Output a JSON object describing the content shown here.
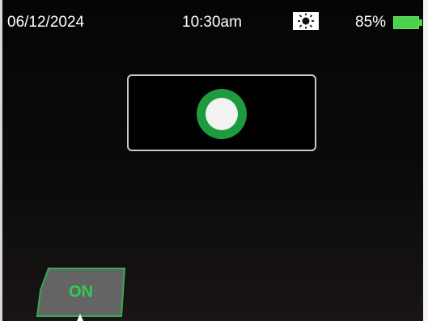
{
  "status_bar": {
    "date": "06/12/2024",
    "time": "10:30am",
    "brightness_icon": "sun-icon",
    "battery_percent_text": "85%",
    "battery_level": 0.85,
    "battery_color": "#4bd14b"
  },
  "record_control": {
    "icon": "record-icon",
    "ring_color": "#1e9b3c"
  },
  "power_button": {
    "label": "ON",
    "accent_color": "#2ecc55"
  }
}
